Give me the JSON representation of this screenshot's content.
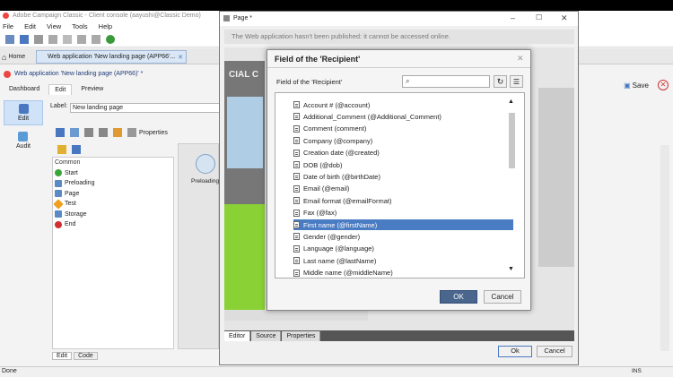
{
  "app": {
    "title": "Adobe Campaign Classic - Client console (aayushi@Classic Demo)",
    "menu": [
      "File",
      "Edit",
      "View",
      "Tools",
      "Help"
    ],
    "tabs": {
      "home": "Home",
      "webapp": "Web application 'New landing page (APP66'..."
    },
    "object_title": "Web application 'New landing page (APP66)' *",
    "subtabs": [
      "Dashboard",
      "Edit",
      "Preview"
    ],
    "leftnav": [
      "Edit",
      "Audit"
    ],
    "label_caption": "Label:",
    "label_value": "New landing page",
    "properties": "Properties",
    "palette_header": "Common",
    "palette_items": [
      "Start",
      "Preloading",
      "Page",
      "Test",
      "Storage",
      "End"
    ],
    "canvas_node_label": "Preloading",
    "bottom_tabs": [
      "Edit",
      "Code"
    ],
    "save": "Save",
    "status": "Done",
    "status_right": "INS"
  },
  "page_window": {
    "title": "Page *",
    "warning": "The Web application hasn't been published: it cannot be accessed online.",
    "logo_text": "CIAL C",
    "tabs": [
      "Editor",
      "Source",
      "Properties"
    ],
    "ok": "Ok",
    "cancel": "Cancel"
  },
  "field_dialog": {
    "title": "Field of the 'Recipient'",
    "label": "Field of the 'Recipient'",
    "search_placeholder": "",
    "items": [
      "Account # (@account)",
      "Additional_Comment (@Additional_Comment)",
      "Comment (comment)",
      "Company (@company)",
      "Creation date (@created)",
      "DOB (@dob)",
      "Date of birth (@birthDate)",
      "Email (@email)",
      "Email format (@emailFormat)",
      "Fax (@fax)",
      "First name (@firstName)",
      "Gender (@gender)",
      "Language (@language)",
      "Last name (@lastName)",
      "Middle name (@middleName)"
    ],
    "selected_index": 10,
    "ok": "OK",
    "cancel": "Cancel"
  },
  "colors": {
    "accent": "#4a7cc4",
    "ok_button": "#4a668c",
    "landing_green": "#8ad135"
  }
}
